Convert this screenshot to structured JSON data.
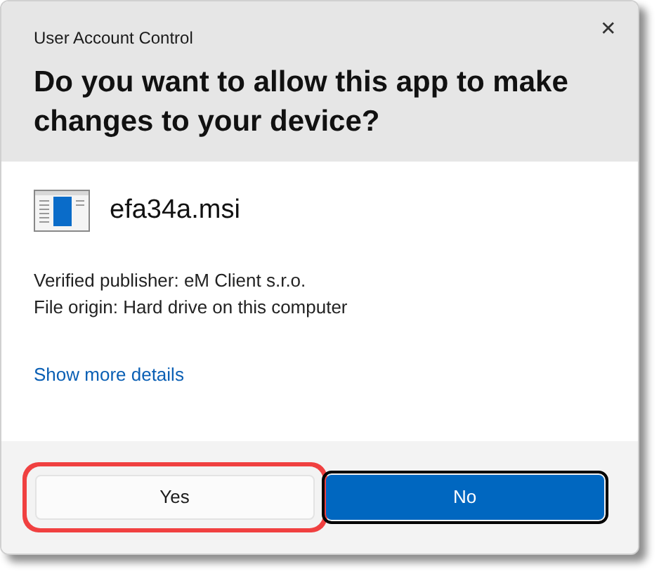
{
  "window": {
    "title": "User Account Control",
    "close": "✕"
  },
  "heading": "Do you want to allow this app to make changes to your device?",
  "app": {
    "name": "efa34a.msi"
  },
  "details": [
    "Verified publisher: eM Client s.r.o.",
    "File origin: Hard drive on this computer"
  ],
  "link": "Show more details",
  "buttons": [
    {
      "label": "Yes",
      "kind": "secondary",
      "highlighted": true,
      "focused": false
    },
    {
      "label": "No",
      "kind": "primary",
      "highlighted": false,
      "focused": true
    }
  ]
}
